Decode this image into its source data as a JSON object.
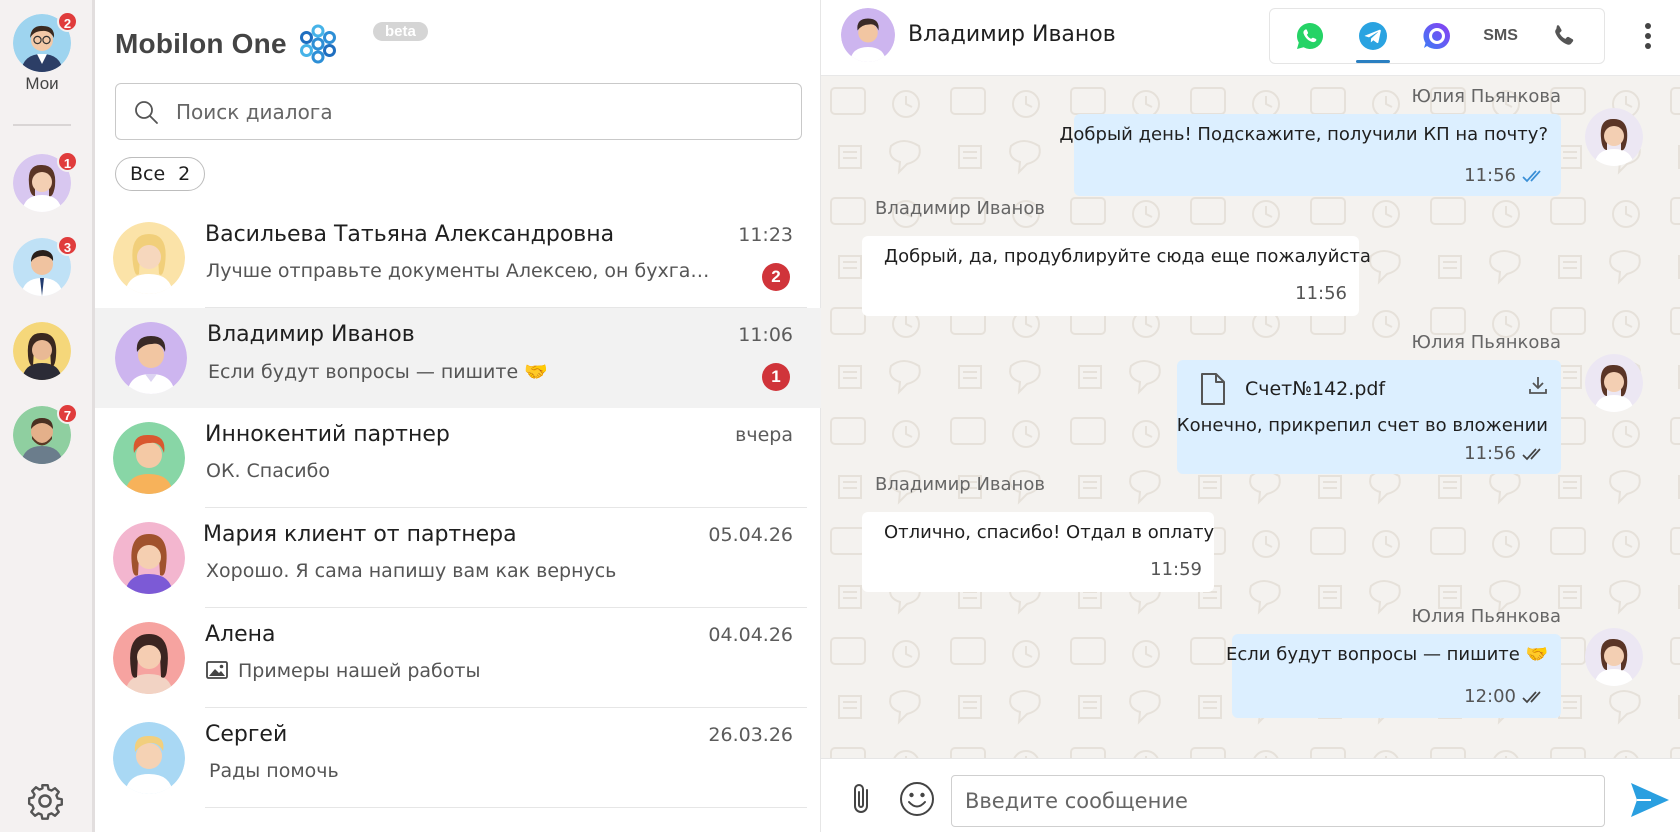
{
  "rail": {
    "me_label": "Мои",
    "items": [
      {
        "name": "my-account",
        "badge": "2"
      },
      {
        "name": "operator-1",
        "badge": "1"
      },
      {
        "name": "operator-2",
        "badge": "3"
      },
      {
        "name": "operator-3",
        "badge": ""
      },
      {
        "name": "operator-4",
        "badge": "7"
      }
    ],
    "settings_icon": "gear-icon"
  },
  "brand": {
    "title": "Mobilon One",
    "beta": "beta"
  },
  "search": {
    "placeholder": "Поиск диалога",
    "value": ""
  },
  "filter": {
    "label": "Все",
    "count": "2"
  },
  "dialogs": [
    {
      "name": "Васильева Татьяна Александровна",
      "time": "11:23",
      "preview": "Лучше отправьте документы Алексею, он бухгалтер",
      "badge": "2",
      "active": false
    },
    {
      "name": "Владимир Иванов",
      "time": "11:06",
      "preview": "Если будут вопросы — пишите 🤝",
      "badge": "1",
      "active": true
    },
    {
      "name": "Иннокентий партнер",
      "time": "вчера",
      "preview": "ОК. Спасибо",
      "badge": "",
      "active": false
    },
    {
      "name": "Мария клиент от партнера",
      "time": "05.04.26",
      "preview": "Хорошо. Я сама напишу вам как вернусь",
      "badge": "",
      "active": false
    },
    {
      "name": "Алена",
      "time": "04.04.26",
      "preview": "Примеры нашей работы",
      "badge": "",
      "active": false,
      "preview_icon": "image-icon"
    },
    {
      "name": "Сергей",
      "time": "26.03.26",
      "preview": "Рады помочь",
      "badge": "",
      "active": false
    }
  ],
  "chat": {
    "title": "Владимир Иванов",
    "channels": [
      {
        "name": "whatsapp",
        "icon": "whatsapp-icon",
        "active": false
      },
      {
        "name": "telegram",
        "icon": "telegram-icon",
        "active": true
      },
      {
        "name": "max",
        "icon": "messenger-icon",
        "active": false
      },
      {
        "name": "sms",
        "label": "SMS",
        "active": false
      },
      {
        "name": "call",
        "icon": "phone-icon",
        "active": false
      }
    ],
    "messages": [
      {
        "direction": "out",
        "sender": "Юлия Пьянкова",
        "text": "Добрый день! Подскажите, получили КП на почту?",
        "time": "11:56",
        "read": true
      },
      {
        "direction": "in",
        "sender": "Владимир Иванов",
        "text": "Добрый, да, продублируйте сюда еще пожалуйста",
        "time": "11:56"
      },
      {
        "direction": "out",
        "sender": "Юлия Пьянкова",
        "file": "Счет№142.pdf",
        "text": "Конечно, прикрепил счет во вложении",
        "time": "11:56",
        "read": true
      },
      {
        "direction": "in",
        "sender": "Владимир Иванов",
        "text": "Отлично, спасибо! Отдал в оплату",
        "time": "11:59"
      },
      {
        "direction": "out",
        "sender": "Юлия Пьянкова",
        "text": "Если будут вопросы — пишите 🤝",
        "time": "12:00",
        "read": true
      }
    ],
    "composer_placeholder": "Введите сообщение"
  },
  "colors": {
    "badge": "#e03c3c",
    "outgoing_bubble": "#dcefff",
    "incoming_bubble": "#ffffff",
    "accent": "#2a9fe0",
    "whatsapp": "#25d366",
    "telegram": "#2aa3e1",
    "messenger": "#6a4cf5"
  }
}
